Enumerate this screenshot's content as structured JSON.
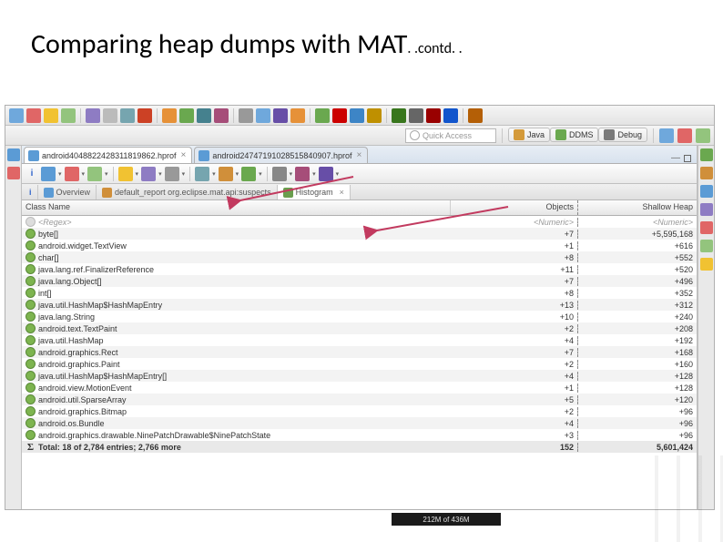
{
  "slide": {
    "title": "Comparing heap dumps with MAT",
    "contd": ". .contd. ."
  },
  "quick_access": {
    "placeholder": "Quick Access"
  },
  "perspectives": [
    {
      "label": "Java",
      "color": "#d49a3a"
    },
    {
      "label": "DDMS",
      "color": "#6aa84f"
    },
    {
      "label": "Debug",
      "color": "#7a7a7a"
    }
  ],
  "tabs": [
    {
      "label": "android4048822428311819862.hprof",
      "active": true
    },
    {
      "label": "android24747191028515840907.hprof",
      "active": false
    }
  ],
  "sub_tabs": [
    {
      "label": "Overview",
      "icon": "#5b9bd5",
      "active": false
    },
    {
      "label": "default_report org.eclipse.mat.api:suspects",
      "icon": "#d08f3a",
      "active": false
    },
    {
      "label": "Histogram",
      "icon": "#6a9e4e",
      "active": true
    }
  ],
  "columns": {
    "name": "Class Name",
    "objects": "Objects",
    "shallow": "Shallow Heap"
  },
  "regex_row": {
    "name": "<Regex>",
    "objects": "<Numeric>",
    "shallow": "<Numeric>"
  },
  "rows": [
    {
      "name": "byte[]",
      "obj": "+7",
      "heap": "+5,595,168"
    },
    {
      "name": "android.widget.TextView",
      "obj": "+1",
      "heap": "+616"
    },
    {
      "name": "char[]",
      "obj": "+8",
      "heap": "+552"
    },
    {
      "name": "java.lang.ref.FinalizerReference",
      "obj": "+11",
      "heap": "+520"
    },
    {
      "name": "java.lang.Object[]",
      "obj": "+7",
      "heap": "+496"
    },
    {
      "name": "int[]",
      "obj": "+8",
      "heap": "+352"
    },
    {
      "name": "java.util.HashMap$HashMapEntry",
      "obj": "+13",
      "heap": "+312"
    },
    {
      "name": "java.lang.String",
      "obj": "+10",
      "heap": "+240"
    },
    {
      "name": "android.text.TextPaint",
      "obj": "+2",
      "heap": "+208"
    },
    {
      "name": "java.util.HashMap",
      "obj": "+4",
      "heap": "+192"
    },
    {
      "name": "android.graphics.Rect",
      "obj": "+7",
      "heap": "+168"
    },
    {
      "name": "android.graphics.Paint",
      "obj": "+2",
      "heap": "+160"
    },
    {
      "name": "java.util.HashMap$HashMapEntry[]",
      "obj": "+4",
      "heap": "+128"
    },
    {
      "name": "android.view.MotionEvent",
      "obj": "+1",
      "heap": "+128"
    },
    {
      "name": "android.util.SparseArray",
      "obj": "+5",
      "heap": "+120"
    },
    {
      "name": "android.graphics.Bitmap",
      "obj": "+2",
      "heap": "+96"
    },
    {
      "name": "android.os.Bundle",
      "obj": "+4",
      "heap": "+96"
    },
    {
      "name": "android.graphics.drawable.NinePatchDrawable$NinePatchState",
      "obj": "+3",
      "heap": "+96"
    }
  ],
  "total_row": {
    "label": "Total: 18 of 2,784 entries; 2,766 more",
    "objects": "152",
    "heap": "5,601,424"
  },
  "status": {
    "mem": "212M of 436M"
  },
  "toolbar_icons": [
    "#6fa8dc",
    "#e06666",
    "#f1c232",
    "#93c47d",
    "#8e7cc3",
    "#bbbbbb",
    "#76a5af",
    "#cc4125",
    "#e69138",
    "#6aa84f",
    "#45818e",
    "#a64d79",
    "#999999",
    "#6fa8dc",
    "#674ea7",
    "#e69138",
    "#6aa84f",
    "#cc0000",
    "#3d85c6",
    "#bf9000",
    "#38761d",
    "#666666",
    "#990000",
    "#1155cc",
    "#b45f06"
  ],
  "inner_toolbar_icons": [
    "#5b9bd5",
    "#e06666",
    "#93c47d",
    "#f1c232",
    "#8e7cc3",
    "#999999",
    "#76a5af",
    "#d08f3a",
    "#6aa84f",
    "#888888",
    "#a64d79",
    "#674ea7"
  ],
  "left_gutter_icons": [
    "#5b9bd5",
    "#e06666"
  ],
  "right_gutter_icons": [
    "#6aa84f",
    "#d08f3a",
    "#5b9bd5",
    "#8e7cc3",
    "#e06666",
    "#93c47d",
    "#f1c232"
  ]
}
